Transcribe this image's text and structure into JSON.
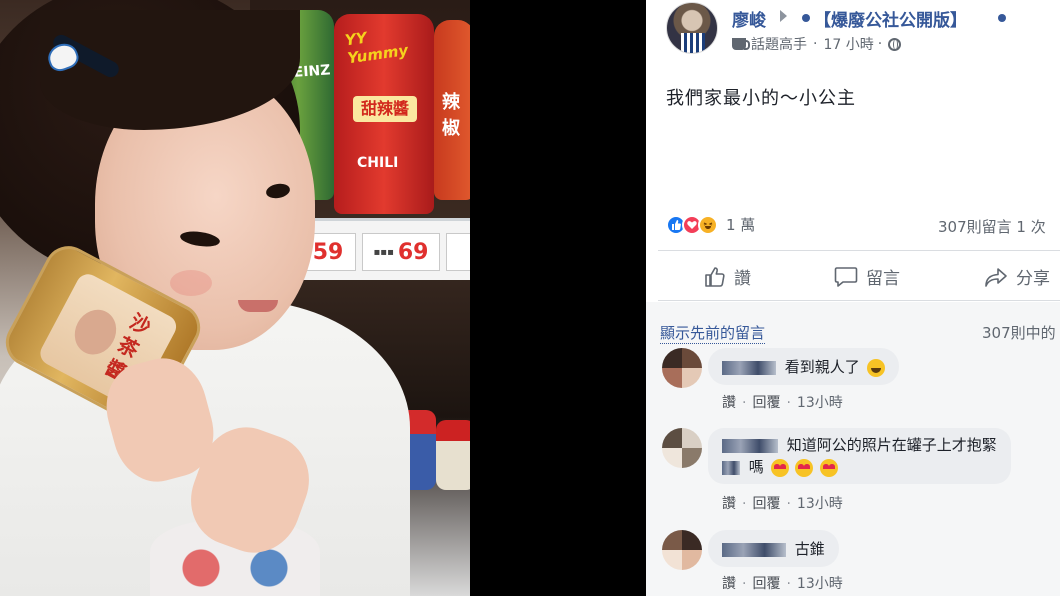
{
  "post": {
    "author": "廖峻",
    "group": "【爆廢公社公開版】",
    "badge": "話題高手",
    "time": "17 小時",
    "text": "我們家最小的～小公主",
    "reactions_count": "1 萬",
    "comments_summary": "307則留言  1 次",
    "actions": {
      "like": "讚",
      "comment": "留言",
      "share": "分享"
    }
  },
  "comments_section": {
    "prev_link": "顯示先前的留言",
    "of_count": "307則中的",
    "items": [
      {
        "text": "看到親人了",
        "like": "讚",
        "reply": "回覆",
        "time": "13小時"
      },
      {
        "text_line1": "知道阿公的照片在罐子上才抱緊",
        "text_line2": "嗎",
        "like": "讚",
        "reply": "回覆",
        "time": "13小時"
      },
      {
        "text": "古錐",
        "like": "讚",
        "reply": "回覆",
        "time": "13小時"
      }
    ]
  },
  "photo": {
    "price_1": "59",
    "price_2": "69",
    "brand_yy": "YY Yummy",
    "brand_heinz": "HEINZ",
    "label_sweet": "甜辣醬",
    "label_chili": "CHILI",
    "label_spicy": "辣椒",
    "jar_text": "沙茶醬"
  },
  "colors": {
    "link": "#365899",
    "like_blue": "#1877f2",
    "panel_bg": "#ffffff",
    "comments_bg": "#f5f6f7"
  }
}
